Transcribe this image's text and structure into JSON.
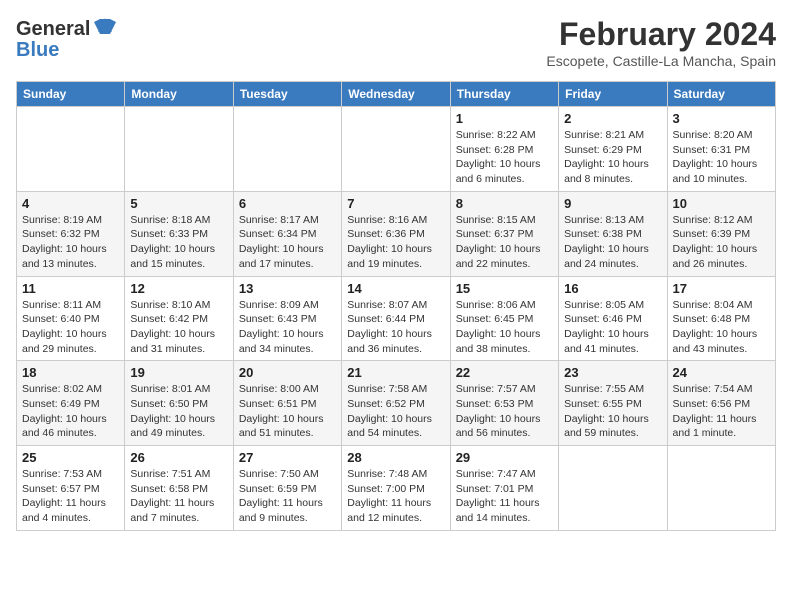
{
  "logo": {
    "general": "General",
    "blue": "Blue"
  },
  "title": "February 2024",
  "location": "Escopete, Castille-La Mancha, Spain",
  "headers": [
    "Sunday",
    "Monday",
    "Tuesday",
    "Wednesday",
    "Thursday",
    "Friday",
    "Saturday"
  ],
  "weeks": [
    [
      {
        "day": "",
        "info": ""
      },
      {
        "day": "",
        "info": ""
      },
      {
        "day": "",
        "info": ""
      },
      {
        "day": "",
        "info": ""
      },
      {
        "day": "1",
        "info": "Sunrise: 8:22 AM\nSunset: 6:28 PM\nDaylight: 10 hours\nand 6 minutes."
      },
      {
        "day": "2",
        "info": "Sunrise: 8:21 AM\nSunset: 6:29 PM\nDaylight: 10 hours\nand 8 minutes."
      },
      {
        "day": "3",
        "info": "Sunrise: 8:20 AM\nSunset: 6:31 PM\nDaylight: 10 hours\nand 10 minutes."
      }
    ],
    [
      {
        "day": "4",
        "info": "Sunrise: 8:19 AM\nSunset: 6:32 PM\nDaylight: 10 hours\nand 13 minutes."
      },
      {
        "day": "5",
        "info": "Sunrise: 8:18 AM\nSunset: 6:33 PM\nDaylight: 10 hours\nand 15 minutes."
      },
      {
        "day": "6",
        "info": "Sunrise: 8:17 AM\nSunset: 6:34 PM\nDaylight: 10 hours\nand 17 minutes."
      },
      {
        "day": "7",
        "info": "Sunrise: 8:16 AM\nSunset: 6:36 PM\nDaylight: 10 hours\nand 19 minutes."
      },
      {
        "day": "8",
        "info": "Sunrise: 8:15 AM\nSunset: 6:37 PM\nDaylight: 10 hours\nand 22 minutes."
      },
      {
        "day": "9",
        "info": "Sunrise: 8:13 AM\nSunset: 6:38 PM\nDaylight: 10 hours\nand 24 minutes."
      },
      {
        "day": "10",
        "info": "Sunrise: 8:12 AM\nSunset: 6:39 PM\nDaylight: 10 hours\nand 26 minutes."
      }
    ],
    [
      {
        "day": "11",
        "info": "Sunrise: 8:11 AM\nSunset: 6:40 PM\nDaylight: 10 hours\nand 29 minutes."
      },
      {
        "day": "12",
        "info": "Sunrise: 8:10 AM\nSunset: 6:42 PM\nDaylight: 10 hours\nand 31 minutes."
      },
      {
        "day": "13",
        "info": "Sunrise: 8:09 AM\nSunset: 6:43 PM\nDaylight: 10 hours\nand 34 minutes."
      },
      {
        "day": "14",
        "info": "Sunrise: 8:07 AM\nSunset: 6:44 PM\nDaylight: 10 hours\nand 36 minutes."
      },
      {
        "day": "15",
        "info": "Sunrise: 8:06 AM\nSunset: 6:45 PM\nDaylight: 10 hours\nand 38 minutes."
      },
      {
        "day": "16",
        "info": "Sunrise: 8:05 AM\nSunset: 6:46 PM\nDaylight: 10 hours\nand 41 minutes."
      },
      {
        "day": "17",
        "info": "Sunrise: 8:04 AM\nSunset: 6:48 PM\nDaylight: 10 hours\nand 43 minutes."
      }
    ],
    [
      {
        "day": "18",
        "info": "Sunrise: 8:02 AM\nSunset: 6:49 PM\nDaylight: 10 hours\nand 46 minutes."
      },
      {
        "day": "19",
        "info": "Sunrise: 8:01 AM\nSunset: 6:50 PM\nDaylight: 10 hours\nand 49 minutes."
      },
      {
        "day": "20",
        "info": "Sunrise: 8:00 AM\nSunset: 6:51 PM\nDaylight: 10 hours\nand 51 minutes."
      },
      {
        "day": "21",
        "info": "Sunrise: 7:58 AM\nSunset: 6:52 PM\nDaylight: 10 hours\nand 54 minutes."
      },
      {
        "day": "22",
        "info": "Sunrise: 7:57 AM\nSunset: 6:53 PM\nDaylight: 10 hours\nand 56 minutes."
      },
      {
        "day": "23",
        "info": "Sunrise: 7:55 AM\nSunset: 6:55 PM\nDaylight: 10 hours\nand 59 minutes."
      },
      {
        "day": "24",
        "info": "Sunrise: 7:54 AM\nSunset: 6:56 PM\nDaylight: 11 hours\nand 1 minute."
      }
    ],
    [
      {
        "day": "25",
        "info": "Sunrise: 7:53 AM\nSunset: 6:57 PM\nDaylight: 11 hours\nand 4 minutes."
      },
      {
        "day": "26",
        "info": "Sunrise: 7:51 AM\nSunset: 6:58 PM\nDaylight: 11 hours\nand 7 minutes."
      },
      {
        "day": "27",
        "info": "Sunrise: 7:50 AM\nSunset: 6:59 PM\nDaylight: 11 hours\nand 9 minutes."
      },
      {
        "day": "28",
        "info": "Sunrise: 7:48 AM\nSunset: 7:00 PM\nDaylight: 11 hours\nand 12 minutes."
      },
      {
        "day": "29",
        "info": "Sunrise: 7:47 AM\nSunset: 7:01 PM\nDaylight: 11 hours\nand 14 minutes."
      },
      {
        "day": "",
        "info": ""
      },
      {
        "day": "",
        "info": ""
      }
    ]
  ]
}
